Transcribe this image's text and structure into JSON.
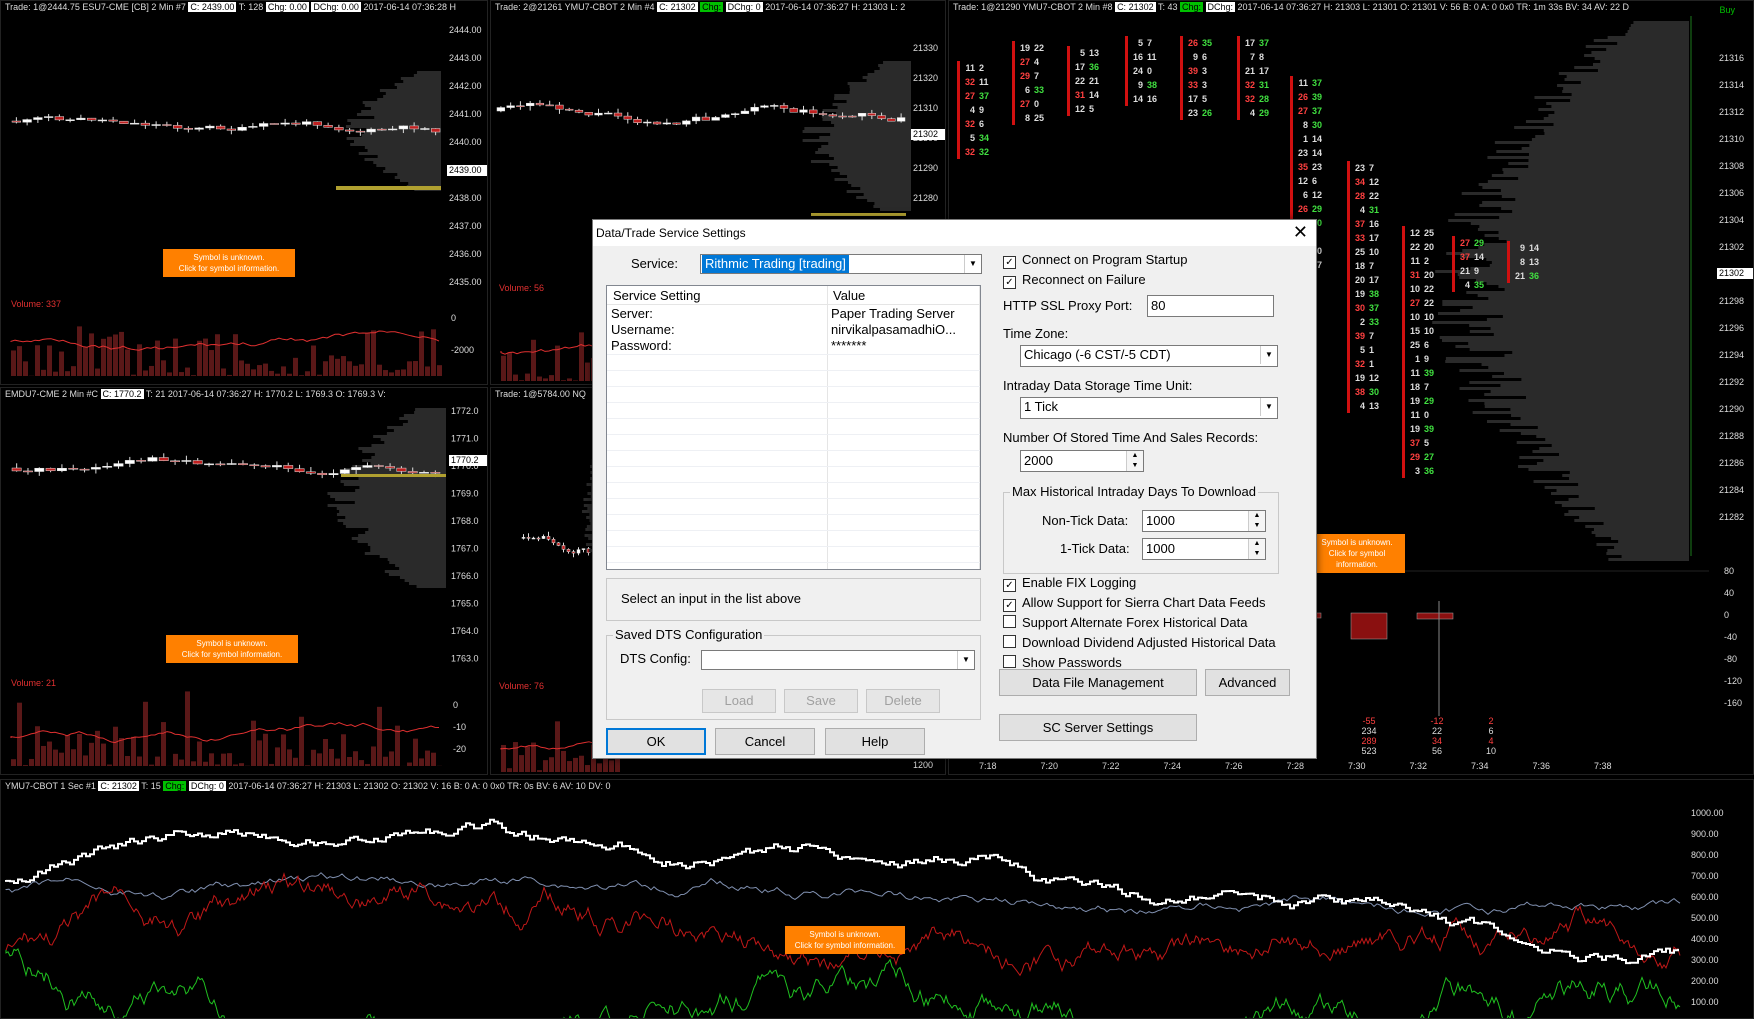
{
  "panes": {
    "es": {
      "header": "Trade: 1@2444.75  ESU7-CME [CB]  2 Min  #7",
      "header_c": "C: 2439.00",
      "header_t": "T: 128",
      "header_chg": "Chg: 0.00",
      "header_dchg": "DChg: 0.00",
      "header_rest": "2017-06-14 07:36:28 H",
      "price_labels": [
        "2444.00",
        "2443.00",
        "2442.00",
        "2441.00",
        "2440.00",
        "2439.00",
        "2438.00",
        "2437.00",
        "2436.00",
        "2435.00"
      ],
      "current_price": "2439.00",
      "volume_label": "Volume: 337",
      "volume_axis": [
        "0",
        "-2000"
      ],
      "unknown_text": "Symbol is unknown.\nClick for symbol information."
    },
    "ym_top": {
      "header": "Trade: 2@21261  YMU7-CBOT  2 Min  #4",
      "header_c": "C: 21302",
      "header_chg": "Chg:",
      "header_dchg": "DChg: 0",
      "header_rest": "2017-06-14 07:36:27 H: 21303 L: 2",
      "price_labels": [
        "21330",
        "21320",
        "21310",
        "21300",
        "21290",
        "21280"
      ],
      "current_price": "21302",
      "volume_label": "Volume: 56"
    },
    "ym_fp": {
      "header": "Trade: 1@21290  YMU7-CBOT  2 Min  #8",
      "header_c": "C: 21302",
      "header_t": "T: 43",
      "header_chg": "Chg:",
      "header_dchg": "DChg:",
      "header_rest": "2017-06-14 07:36:27 H: 21303 L: 21301 O: 21301 V: 56 B: 0 A: 0 0x0 TR: 1m 33s BV: 34 AV: 22 D",
      "buy_label": "Buy",
      "price_labels": [
        "21316",
        "21314",
        "21312",
        "21310",
        "21308",
        "21306",
        "21304",
        "21302",
        "21300",
        "21298",
        "21296",
        "21294",
        "21292",
        "21290",
        "21288",
        "21286",
        "21284",
        "21282"
      ],
      "current_price": "21302",
      "delta_axis": [
        "80",
        "40",
        "0",
        "-40",
        "-80",
        "-120",
        "-160"
      ],
      "time_labels": [
        "7:18",
        "7:20",
        "7:22",
        "7:24",
        "7:26",
        "7:28",
        "7:30",
        "7:32",
        "7:34",
        "7:36",
        "7:38"
      ],
      "unknown_text": "Symbol is unknown.\nClick for symbol information."
    },
    "emd": {
      "header": "EMDU7-CME  2 Min  #C",
      "header_c": "C: 1770.2",
      "header_rest": "T: 21   2017-06-14 07:36:27 H: 1770.2 L: 1769.3 O: 1769.3 V:",
      "price_labels": [
        "1772.0",
        "1771.0",
        "1770.0",
        "1769.0",
        "1768.0",
        "1767.0",
        "1766.0",
        "1765.0",
        "1764.0",
        "1763.0"
      ],
      "current_price": "1770.2",
      "volume_label": "Volume: 21",
      "volume_axis": [
        "0",
        "-10",
        "-20"
      ],
      "unknown_text": "Symbol is unknown.\nClick for symbol information."
    },
    "nq": {
      "header": "Trade: 1@5784.00  NQ",
      "volume_label": "Volume: 76",
      "bottom_axis": "1200"
    },
    "bottom": {
      "header": "YMU7-CBOT  1 Sec  #1",
      "header_c": "C: 21302",
      "header_t": "T: 15",
      "header_chg": "Chg:",
      "header_dchg": "DChg: 0",
      "header_rest": "2017-06-14 07:36:27 H: 21303 L: 21302 O: 21302 V: 16 B: 0 A: 0 0x0 TR: 0s BV: 6 AV: 10 DV: 0",
      "axis": [
        "1000.00",
        "900.00",
        "800.00",
        "700.00",
        "600.00",
        "500.00",
        "400.00",
        "300.00",
        "200.00",
        "100.00"
      ],
      "unknown_text": "Symbol is unknown.\nClick for symbol information."
    }
  },
  "dialog": {
    "title": "Data/Trade Service Settings",
    "service_label": "Service:",
    "service_value": "Rithmic Trading   [trading]",
    "grid_headers": [
      "Service Setting",
      "Value"
    ],
    "grid_rows": [
      {
        "setting": "Server:",
        "value": "Paper Trading Server"
      },
      {
        "setting": "Username:",
        "value": "nirvikalpasamadhiO..."
      },
      {
        "setting": "Password:",
        "value": "*******"
      }
    ],
    "hint": "Select an input in the list above",
    "saved_dts_title": "Saved DTS Configuration",
    "dts_config_label": "DTS Config:",
    "dts_config_value": "",
    "load": "Load",
    "save": "Save",
    "delete": "Delete",
    "ok": "OK",
    "cancel": "Cancel",
    "help": "Help",
    "connect_startup": "Connect on Program Startup",
    "reconnect_failure": "Reconnect on Failure",
    "proxy_label": "HTTP SSL Proxy Port:",
    "proxy_value": "80",
    "timezone_label": "Time Zone:",
    "timezone_value": "Chicago (-6 CST/-5 CDT)",
    "storage_label": "Intraday Data Storage Time Unit:",
    "storage_value": "1 Tick",
    "records_label": "Number Of Stored Time And Sales Records:",
    "records_value": "2000",
    "maxdays_title": "Max Historical Intraday Days To Download",
    "nontick_label": "Non-Tick Data:",
    "nontick_value": "1000",
    "onetick_label": "1-Tick Data:",
    "onetick_value": "1000",
    "fix_logging": "Enable FIX Logging",
    "sc_feeds": "Allow Support for Sierra Chart Data Feeds",
    "alt_forex": "Support Alternate Forex Historical Data",
    "dividend": "Download Dividend Adjusted Historical Data",
    "show_passwords": "Show Passwords",
    "data_file_mgmt": "Data File Management",
    "advanced": "Advanced",
    "sc_server": "SC Server Settings",
    "checks": {
      "connect_startup": true,
      "reconnect_failure": true,
      "fix_logging": true,
      "sc_feeds": true,
      "alt_forex": false,
      "dividend": false,
      "show_passwords": false
    }
  }
}
